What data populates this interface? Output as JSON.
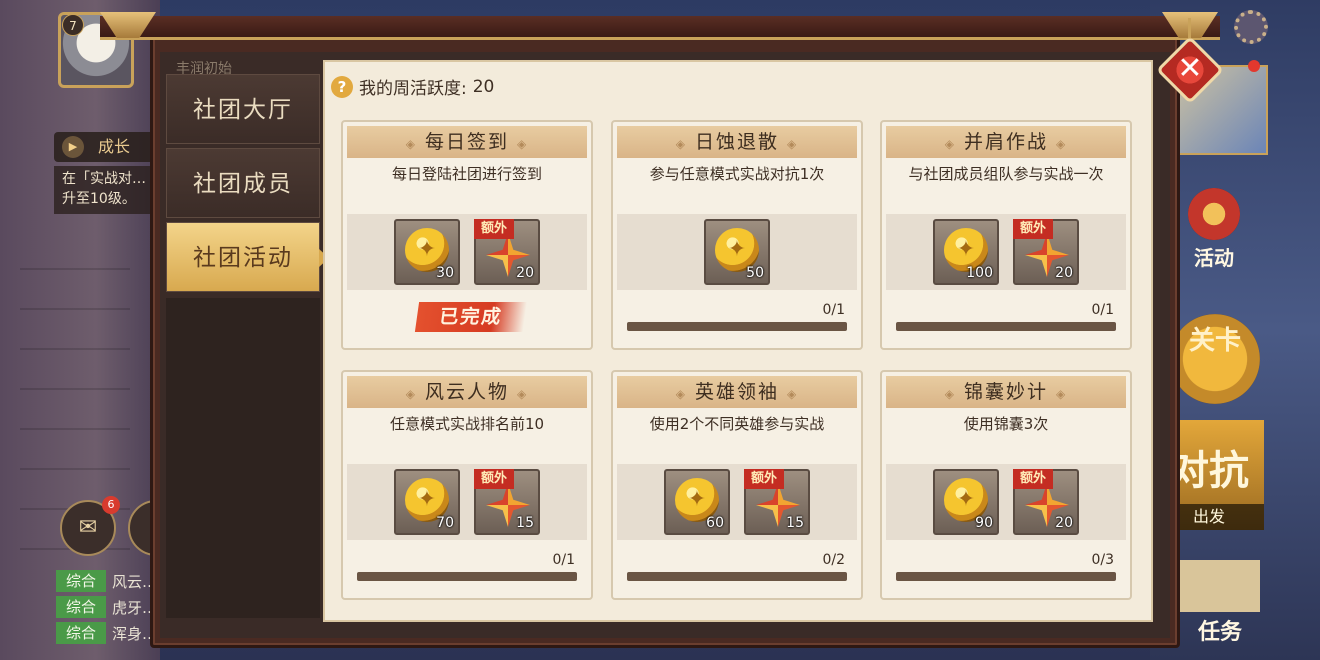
{
  "player": {
    "level": "7"
  },
  "growth": {
    "label": "成长",
    "desc": "在「实战对…升至10级。"
  },
  "mail": {
    "badge": "6"
  },
  "chat": [
    {
      "tag": "综合",
      "text": "风云…白芷:人死…"
    },
    {
      "tag": "综合",
      "text": "虎牙…、要命人死,都…"
    },
    {
      "tag": "综合",
      "text": "浑身…"
    }
  ],
  "side": {
    "activity_label": "活动",
    "stage_label": "关卡",
    "duikang_label": "对抗",
    "depart_label": "出发",
    "task_label": "任务"
  },
  "tabs": [
    {
      "label": "社团大厅"
    },
    {
      "label": "社团成员"
    },
    {
      "label": "社团活动",
      "active": true
    }
  ],
  "tab_top_label": "丰润初始",
  "activity": {
    "label": "我的周活跃度:",
    "value": "20"
  },
  "cards": [
    {
      "title": "每日签到",
      "desc": "每日登陆社团进行签到",
      "rewards": [
        {
          "icon": "coin-icon",
          "amount": "30"
        },
        {
          "icon": "pinwheel-icon",
          "amount": "20",
          "extra": "额外"
        }
      ],
      "status": "已完成"
    },
    {
      "title": "日蚀退散",
      "desc": "参与任意模式实战对抗1次",
      "rewards": [
        {
          "icon": "coin-icon",
          "amount": "50"
        }
      ],
      "progress": "0/1",
      "fill": 0
    },
    {
      "title": "并肩作战",
      "desc": "与社团成员组队参与实战一次",
      "rewards": [
        {
          "icon": "coin-icon",
          "amount": "100"
        },
        {
          "icon": "pinwheel-icon",
          "amount": "20",
          "extra": "额外"
        }
      ],
      "progress": "0/1",
      "fill": 0
    },
    {
      "title": "风云人物",
      "desc": "任意模式实战排名前10",
      "rewards": [
        {
          "icon": "coin-icon",
          "amount": "70"
        },
        {
          "icon": "pinwheel-icon",
          "amount": "15",
          "extra": "额外"
        }
      ],
      "progress": "0/1",
      "fill": 0
    },
    {
      "title": "英雄领袖",
      "desc": "使用2个不同英雄参与实战",
      "rewards": [
        {
          "icon": "coin-icon",
          "amount": "60"
        },
        {
          "icon": "pinwheel-icon",
          "amount": "15",
          "extra": "额外"
        }
      ],
      "progress": "0/2",
      "fill": 0
    },
    {
      "title": "锦囊妙计",
      "desc": "使用锦囊3次",
      "rewards": [
        {
          "icon": "coin-icon",
          "amount": "90"
        },
        {
          "icon": "pinwheel-icon",
          "amount": "20",
          "extra": "额外"
        }
      ],
      "progress": "0/3",
      "fill": 0
    }
  ],
  "colors": {
    "accent": "#e2a93f",
    "panel": "#f3ebdb",
    "extra_tag": "#c42c22",
    "done_stamp": "#e4512e"
  }
}
